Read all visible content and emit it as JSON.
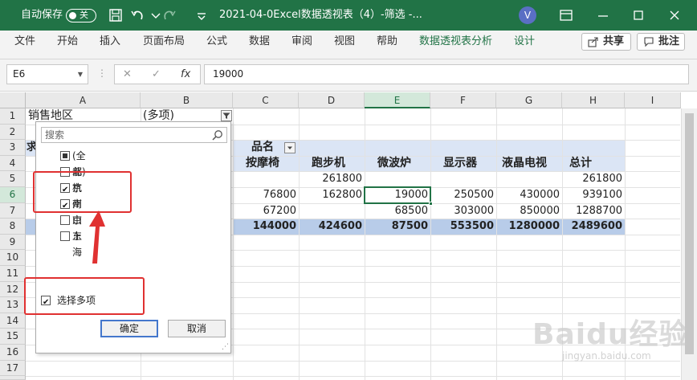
{
  "titlebar": {
    "autosave_label": "自动保存",
    "autosave_state": "关",
    "filename": "2021-04-0Excel数据透视表（4）-筛选 -...",
    "avatar_letter": "V"
  },
  "tabs": [
    "文件",
    "开始",
    "插入",
    "页面布局",
    "公式",
    "数据",
    "审阅",
    "视图",
    "帮助",
    "数据透视表分析",
    "设计"
  ],
  "ribbon_buttons": {
    "share": "共享",
    "comment": "批注"
  },
  "formula_bar": {
    "name_box": "E6",
    "cancel": "✕",
    "enter": "✓",
    "fx": "fx",
    "value": "19000"
  },
  "columns": [
    "A",
    "B",
    "C",
    "D",
    "E",
    "F",
    "G",
    "H",
    "I"
  ],
  "rows": [
    "1",
    "2",
    "3",
    "4",
    "5",
    "6",
    "7",
    "8",
    "9",
    "10",
    "11",
    "12",
    "13",
    "14",
    "15",
    "16",
    "17",
    "18"
  ],
  "cells": {
    "a1": "销售地区",
    "b1": "(多项)",
    "a3": "求",
    "c3": "品名",
    "c4": "按摩椅",
    "d4": "跑步机",
    "e4": "微波炉",
    "f4": "显示器",
    "g4": "液晶电视",
    "h4": "总计",
    "d5": "261800",
    "h5": "261800",
    "c6": "76800",
    "d6": "162800",
    "e6": "19000",
    "f6": "250500",
    "g6": "430000",
    "h6": "939100",
    "c7": "67200",
    "e7": "68500",
    "f7": "303000",
    "g7": "850000",
    "h7": "1288700",
    "c8": "144000",
    "d8": "424600",
    "e8": "87500",
    "f8": "553500",
    "g8": "1280000",
    "h8": "2489600"
  },
  "filter_panel": {
    "search_placeholder": "搜索",
    "items": [
      {
        "label": "(全部)",
        "state": "partial"
      },
      {
        "label": "北京",
        "state": "unchecked"
      },
      {
        "label": "杭州",
        "state": "checked"
      },
      {
        "label": "南京",
        "state": "checked"
      },
      {
        "label": "山东",
        "state": "unchecked"
      },
      {
        "label": "上海",
        "state": "unchecked"
      }
    ],
    "select_multiple": "选择多项",
    "ok": "确定",
    "cancel": "取消"
  },
  "watermark": {
    "logo": "Baidu经验",
    "url": "jingyan.baidu.com"
  },
  "colors": {
    "excel_green": "#217346",
    "pivot_header": "#dbe5f5",
    "pivot_total": "#b8cce9",
    "annotation_red": "#e03131"
  }
}
